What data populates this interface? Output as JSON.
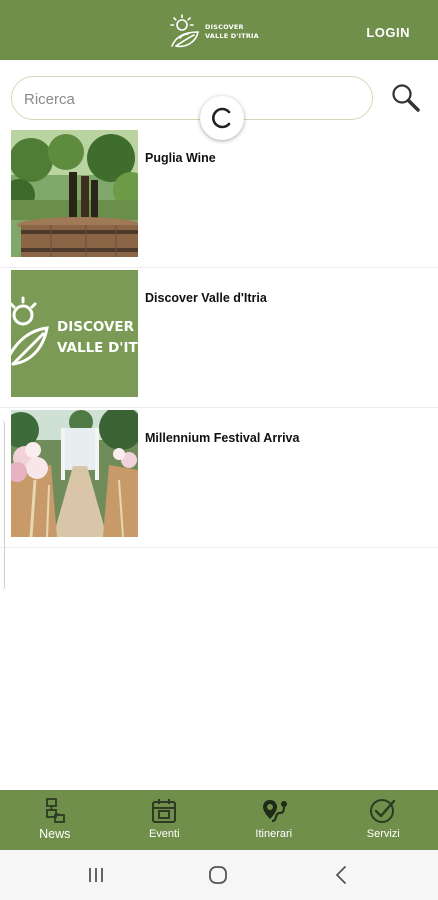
{
  "header": {
    "logo_line1": "DISCOVER",
    "logo_line2": "VALLE D'ITRIA",
    "login_label": "LOGIN",
    "color": "#6f8f4b"
  },
  "search": {
    "placeholder": "Ricerca",
    "value": "",
    "icon": "search-icon"
  },
  "loading": {
    "icon": "loading-spinner"
  },
  "articles": [
    {
      "title": "Puglia Wine",
      "image": "wine-barrel-vineyard-photo"
    },
    {
      "title": "Discover Valle d'Itria",
      "image": "discover-valle-ditria-logo",
      "image_text_line1": "DISCOVER",
      "image_text_line2": "VALLE D'IT"
    },
    {
      "title": "Millennium Festival Arriva",
      "image": "wedding-aisle-flowers-photo"
    }
  ],
  "bottom_nav": {
    "items": [
      {
        "label": "News",
        "icon": "news-icon",
        "active": true
      },
      {
        "label": "Eventi",
        "icon": "calendar-icon",
        "active": false
      },
      {
        "label": "Itinerari",
        "icon": "map-pin-route-icon",
        "active": false
      },
      {
        "label": "Servizi",
        "icon": "check-badge-icon",
        "active": false
      }
    ]
  },
  "system_nav": {
    "icons": [
      "recent-apps-icon",
      "home-icon",
      "back-icon"
    ]
  }
}
